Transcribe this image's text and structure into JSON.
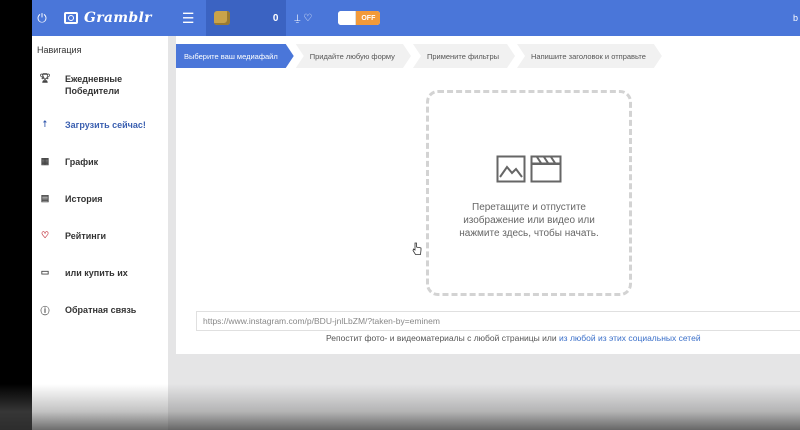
{
  "topbar": {
    "brand": "Gramblr",
    "coin_count": "0",
    "toggle_label": "OFF",
    "right_text": "b"
  },
  "sidebar": {
    "heading": "Навигация",
    "items": [
      {
        "label": "Ежедневные Победители",
        "icon": "trophy-icon"
      },
      {
        "label": "Загрузить сейчас!",
        "icon": "upload-icon"
      },
      {
        "label": "График",
        "icon": "calendar-icon"
      },
      {
        "label": "История",
        "icon": "history-icon"
      },
      {
        "label": "Рейтинги",
        "icon": "heart-icon"
      },
      {
        "label": "или купить их",
        "icon": "wallet-icon"
      },
      {
        "label": "Обратная связь",
        "icon": "help-icon"
      }
    ]
  },
  "steps": [
    "Выберите ваш медиафайл",
    "Придайте любую форму",
    "Примените фильтры",
    "Напишите заголовок и отправьте"
  ],
  "dropzone": {
    "text": "Перетащите и отпустите изображение или видео или нажмите здесь, чтобы начать."
  },
  "url_input": {
    "value": "https://www.instagram.com/p/BDU-jnlLbZM/?taken-by=eminem"
  },
  "repost": {
    "prefix": "Репостит фото- и видеоматериалы с любой страницы или ",
    "link": "из любой из этих социальных сетей"
  },
  "colors": {
    "topbar": "#4a76d9",
    "accent": "#3a5fb0",
    "toggle_off": "#f29a3a"
  }
}
